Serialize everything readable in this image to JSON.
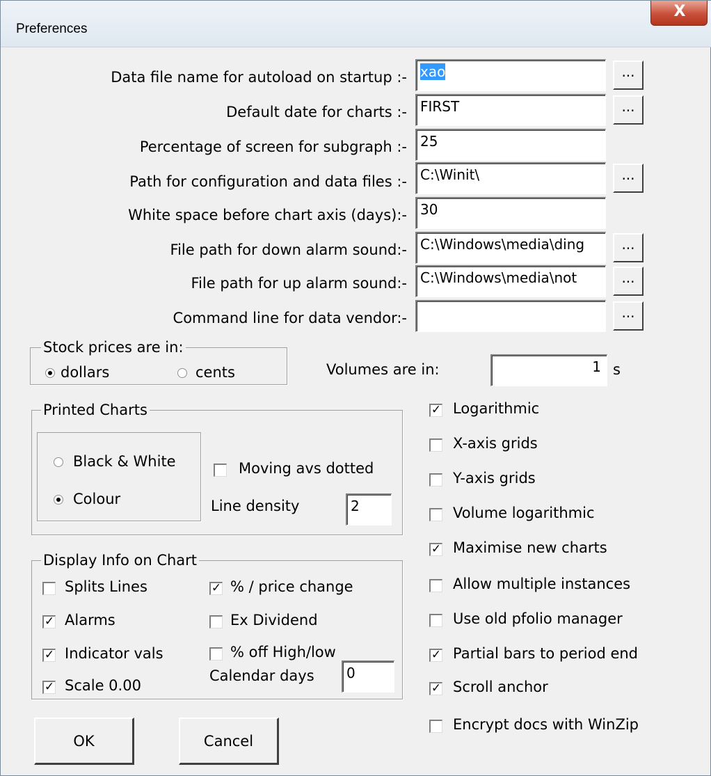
{
  "window": {
    "title": "Preferences",
    "close_glyph": "X"
  },
  "fields": {
    "autoload_label": "Data file name for autoload on startup :-",
    "autoload_value": "xao",
    "default_date_label": "Default date for charts :-",
    "default_date_value": "FIRST",
    "subgraph_label": "Percentage of screen for subgraph :-",
    "subgraph_value": "25",
    "config_path_label": "Path for configuration and data files :-",
    "config_path_value": "C:\\Winit\\",
    "white_space_label": "White space before chart axis (days):-",
    "white_space_value": "30",
    "down_alarm_label": "File path for down alarm sound:-",
    "down_alarm_value": "C:\\Windows\\media\\ding",
    "up_alarm_label": "File path for up alarm sound:-",
    "up_alarm_value": "C:\\Windows\\media\\not",
    "vendor_label": "Command line for data vendor:-",
    "vendor_value": "",
    "browse_label": "..."
  },
  "stock_prices": {
    "legend": "Stock prices are in:",
    "dollars": "dollars",
    "cents": "cents",
    "selected": "dollars"
  },
  "volumes": {
    "label": "Volumes are in:",
    "value": "1",
    "suffix": "s"
  },
  "printed_charts": {
    "legend": "Printed Charts",
    "bw_label": "Black & White",
    "colour_label": "Colour",
    "selected": "Colour",
    "moving_avs_label": "Moving avs dotted",
    "moving_avs_checked": false,
    "line_density_label": "Line density",
    "line_density_value": "2"
  },
  "display_info": {
    "legend": "Display Info on Chart",
    "splits_lines": {
      "label": "Splits Lines",
      "checked": false
    },
    "alarms": {
      "label": "Alarms",
      "checked": true
    },
    "indicator_vals": {
      "label": "Indicator vals",
      "checked": true
    },
    "scale": {
      "label": "Scale 0.00",
      "checked": true
    },
    "price_change": {
      "label": "% / price change",
      "checked": true
    },
    "ex_dividend": {
      "label": "Ex Dividend",
      "checked": false
    },
    "off_high_low": {
      "label": "% off High/low",
      "checked": false
    },
    "calendar_days_label": "Calendar days",
    "calendar_days_value": "0"
  },
  "options": {
    "logarithmic": {
      "label": "Logarithmic",
      "checked": true
    },
    "x_axis_grids": {
      "label": "X-axis grids",
      "checked": false
    },
    "y_axis_grids": {
      "label": "Y-axis grids",
      "checked": false
    },
    "volume_logarithmic": {
      "label": "Volume logarithmic",
      "checked": false
    },
    "maximise_new_charts": {
      "label": "Maximise new charts",
      "checked": true
    },
    "allow_multiple_instances": {
      "label": "Allow multiple instances",
      "checked": false
    },
    "use_old_pfolio_manager": {
      "label": "Use old pfolio manager",
      "checked": false
    },
    "partial_bars": {
      "label": "Partial bars to period end",
      "checked": true
    },
    "scroll_anchor": {
      "label": "Scroll anchor",
      "checked": true
    },
    "encrypt_docs": {
      "label": "Encrypt docs with WinZip",
      "checked": false
    }
  },
  "buttons": {
    "ok": "OK",
    "cancel": "Cancel"
  },
  "glyphs": {
    "check_mark": "✓"
  }
}
